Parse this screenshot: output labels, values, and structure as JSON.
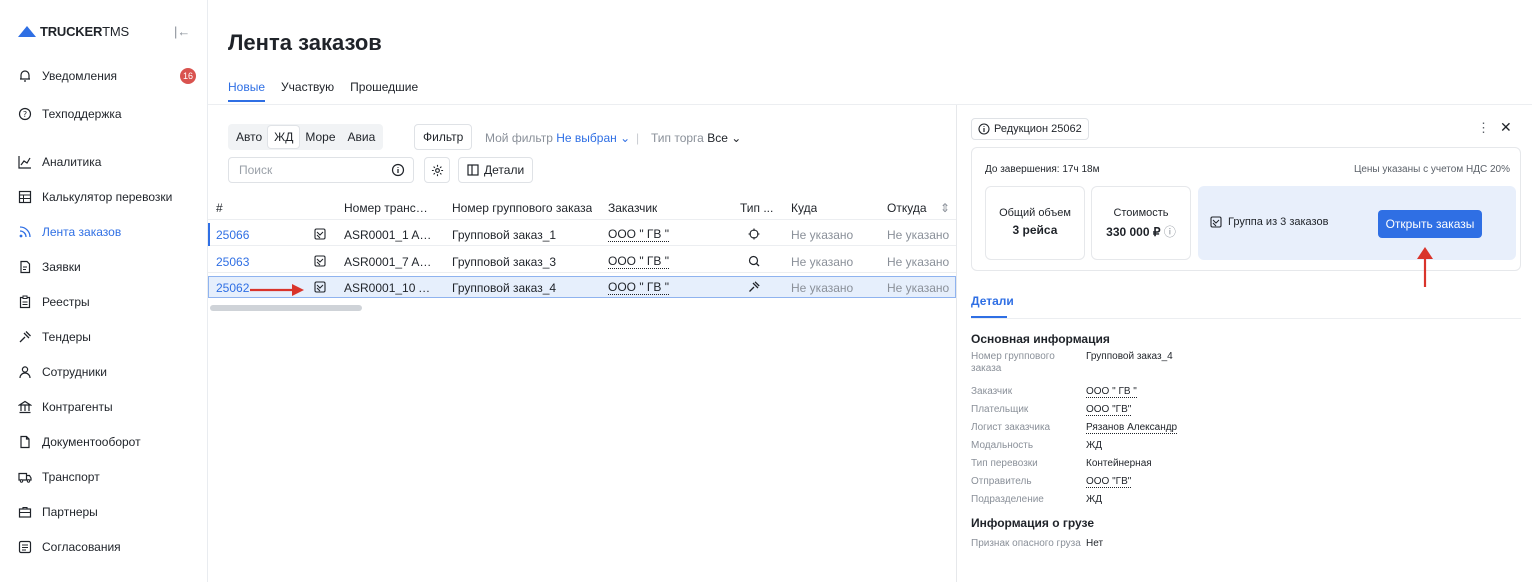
{
  "app": {
    "logo_bold": "TRUCKER",
    "logo_light": "TMS"
  },
  "sidebar": {
    "items": [
      {
        "label": "Уведомления",
        "badge": "16"
      },
      {
        "label": "Техподдержка"
      },
      {
        "label": "Аналитика"
      },
      {
        "label": "Калькулятор перевозки"
      },
      {
        "label": "Лента заказов"
      },
      {
        "label": "Заявки"
      },
      {
        "label": "Реестры"
      },
      {
        "label": "Тендеры"
      },
      {
        "label": "Сотрудники"
      },
      {
        "label": "Контрагенты"
      },
      {
        "label": "Документооборот"
      },
      {
        "label": "Транспорт"
      },
      {
        "label": "Партнеры"
      },
      {
        "label": "Согласования"
      }
    ]
  },
  "header": {
    "title": "Лента заказов",
    "tabs": [
      "Новые",
      "Участвую",
      "Прошедшие"
    ]
  },
  "filters": {
    "modes": [
      "Авто",
      "ЖД",
      "Море",
      "Авиа"
    ],
    "filter_label": "Фильтр",
    "my_filter_label": "Мой фильтр",
    "my_filter_value": "Не выбран",
    "trade_type_label": "Тип торга",
    "trade_type_value": "Все",
    "search_placeholder": "Поиск",
    "details_label": "Детали"
  },
  "table": {
    "columns": [
      "#",
      "Номер транспо...",
      "Номер группового заказа",
      "Заказчик",
      "Тип ...",
      "Куда",
      "Откуда"
    ],
    "rows": [
      {
        "id": "25066",
        "transport": "ASR0001_1 ASR...",
        "group": "Групповой заказ_1",
        "customer": "ООО \" ГВ \"",
        "to": "Не указано",
        "from": "Не указано"
      },
      {
        "id": "25063",
        "transport": "ASR0001_7 ASR...",
        "group": "Групповой заказ_3",
        "customer": "ООО \" ГВ \"",
        "to": "Не указано",
        "from": "Не указано"
      },
      {
        "id": "25062",
        "transport": "ASR0001_10 AS...",
        "group": "Групповой заказ_4",
        "customer": "ООО \" ГВ \"",
        "to": "Не указано",
        "from": "Не указано"
      }
    ]
  },
  "panel": {
    "chip": "Редукцион 25062",
    "time_left": "До завершения: 17ч 18м",
    "vat_note": "Цены указаны с учетом НДС 20%",
    "volume_label": "Общий объем",
    "volume_value": "3 рейса",
    "cost_label": "Стоимость",
    "cost_value": "330 000 ₽",
    "group_label": "Группа из 3 заказов",
    "open_button": "Открыть заказы",
    "details_tab": "Детали",
    "main_info_title": "Основная информация",
    "fields": [
      {
        "k": "Номер группового заказа",
        "v": "Групповой заказ_4"
      },
      {
        "k": "Заказчик",
        "v": "ООО \" ГВ \""
      },
      {
        "k": "Плательщик",
        "v": "ООО \"ГВ\""
      },
      {
        "k": "Логист заказчика",
        "v": "Рязанов Александр"
      },
      {
        "k": "Модальность",
        "v": "ЖД"
      },
      {
        "k": "Тип перевозки",
        "v": "Контейнерная"
      },
      {
        "k": "Отправитель",
        "v": "ООО \"ГВ\""
      },
      {
        "k": "Подразделение",
        "v": "ЖД"
      }
    ],
    "cargo_title": "Информация о грузе",
    "cargo_fields": [
      {
        "k": "Признак опасного груза",
        "v": "Нет"
      }
    ]
  },
  "colors": {
    "accent": "#2f6fe4",
    "annotation": "#d9342b",
    "badge": "#d9534f"
  }
}
